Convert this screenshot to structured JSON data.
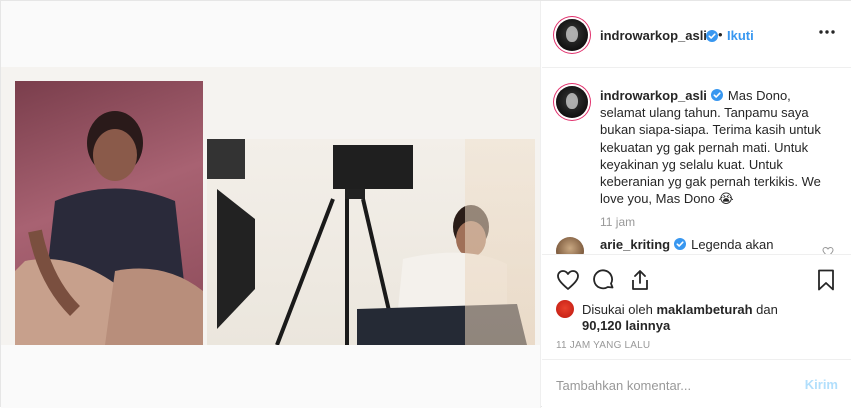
{
  "post": {
    "author": {
      "username": "indrowarkop_asli",
      "verified": true
    },
    "follow_label": "Ikuti",
    "separator": "•",
    "caption": {
      "username": "indrowarkop_asli",
      "text": "Mas Dono, selamat ulang tahun. Tanpamu saya bukan siapa-siapa. Terima kasih untuk kekuatan yg gak pernah mati. Untuk keyakinan yg selalu kuat. Untuk keberanian yg gak pernah terkikis. We love you, Mas Dono 😭",
      "time": "11 jam"
    },
    "comments": [
      {
        "username": "arie_kriting",
        "verified": true,
        "text": "Legenda akan"
      }
    ],
    "likes": {
      "prefix": "Disukai oleh",
      "liked_by": "maklambeturah",
      "middle": "dan",
      "count_text": "90,120 lainnya"
    },
    "timestamp": "11 JAM YANG LALU",
    "comment_box": {
      "placeholder": "Tambahkan komentar...",
      "send_label": "Kirim"
    },
    "colors": {
      "accent": "#3897f0",
      "verified": "#3897f0",
      "send_disabled": "#b2dffc",
      "meta": "#999999"
    },
    "icons": [
      "verified-icon",
      "more-icon",
      "heart-icon",
      "comment-icon",
      "share-icon",
      "bookmark-icon"
    ]
  }
}
